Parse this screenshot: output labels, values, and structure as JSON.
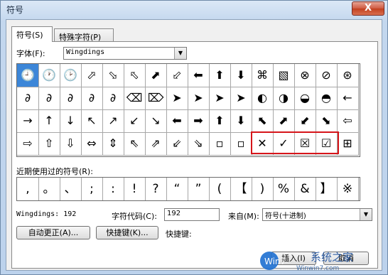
{
  "window": {
    "title": "符号",
    "close_glyph": "X"
  },
  "tabs": [
    {
      "label": "符号(S)"
    },
    {
      "label": "特殊字符(P)"
    }
  ],
  "font": {
    "label": "字体(F):",
    "value": "Wingdings"
  },
  "symbols": {
    "rows": [
      [
        "🕘",
        "🕐",
        "🕑",
        "⬀",
        "⬂",
        "⬁",
        "⬈",
        "⬃",
        "⬅",
        "⬆",
        "⬇",
        "⌘",
        "▧",
        "⊗",
        "⊘",
        "⊛"
      ],
      [
        "∂",
        "∂",
        "∂",
        "∂",
        "∂",
        "⌫",
        "⌦",
        "➤",
        "➤",
        "➤",
        "➤",
        "◐",
        "◑",
        "◒",
        "◓",
        "←"
      ],
      [
        "→",
        "↑",
        "↓",
        "↖",
        "↗",
        "↙",
        "↘",
        "⬅",
        "➡",
        "⬆",
        "⬇",
        "⬉",
        "⬈",
        "⬋",
        "⬊",
        "⇦"
      ],
      [
        "⇨",
        "⇧",
        "⇩",
        "⇔",
        "⇕",
        "⇖",
        "⇗",
        "⇙",
        "⇘",
        "▫",
        "▫",
        "✕",
        "✓",
        "☒",
        "☑",
        "⊞"
      ]
    ],
    "selected_index": 0
  },
  "recent": {
    "label": "近期使用过的符号(R):",
    "items": [
      ",",
      "。",
      "、",
      ";",
      ":",
      "!",
      "?",
      "“",
      "”",
      "(",
      "【",
      ")",
      "%",
      "&",
      "】",
      "※"
    ]
  },
  "status": {
    "font_code": "Wingdings: 192",
    "char_code_label": "字符代码(C):",
    "char_code_value": "192",
    "from_label": "来自(M):",
    "from_value": "符号(十进制)"
  },
  "buttons": {
    "autocorrect": "自动更正(A)...",
    "shortcut_key": "快捷键(K)...",
    "shortcut_label": "快捷键:",
    "insert": "插入(I)",
    "cancel": "取消"
  },
  "watermark": {
    "text": "系统之家",
    "url": "Winwin7.com",
    "logo": "Win7"
  }
}
